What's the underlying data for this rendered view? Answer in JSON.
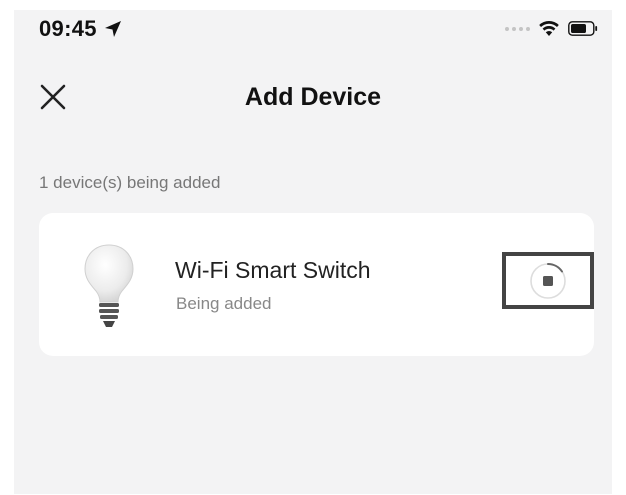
{
  "status_bar": {
    "time": "09:45",
    "location_icon": "location-arrow-icon",
    "wifi_icon": "wifi-icon",
    "battery_icon": "battery-icon"
  },
  "header": {
    "close_icon": "close-icon",
    "title": "Add Device"
  },
  "main": {
    "count_label": "1 device(s) being added",
    "devices": [
      {
        "icon": "light-bulb-icon",
        "name": "Wi-Fi Smart Switch",
        "status": "Being added",
        "action_icon": "stop-progress-icon"
      }
    ]
  },
  "colors": {
    "background": "#f3f3f4",
    "card": "#ffffff",
    "title_text": "#111111",
    "secondary_text": "#888888"
  }
}
